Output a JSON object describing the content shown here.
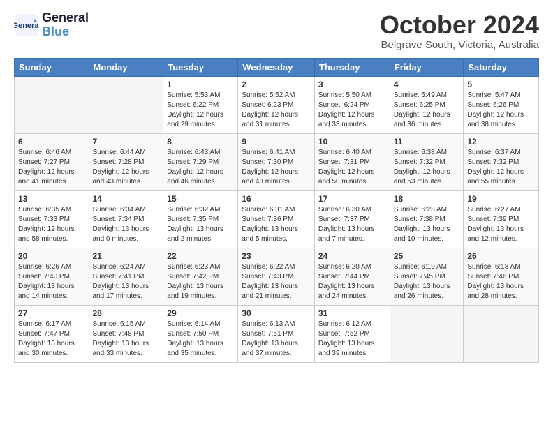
{
  "header": {
    "logo_line1": "General",
    "logo_line2": "Blue",
    "month": "October 2024",
    "location": "Belgrave South, Victoria, Australia"
  },
  "weekdays": [
    "Sunday",
    "Monday",
    "Tuesday",
    "Wednesday",
    "Thursday",
    "Friday",
    "Saturday"
  ],
  "weeks": [
    [
      {
        "day": "",
        "info": ""
      },
      {
        "day": "",
        "info": ""
      },
      {
        "day": "1",
        "info": "Sunrise: 5:53 AM\nSunset: 6:22 PM\nDaylight: 12 hours\nand 29 minutes."
      },
      {
        "day": "2",
        "info": "Sunrise: 5:52 AM\nSunset: 6:23 PM\nDaylight: 12 hours\nand 31 minutes."
      },
      {
        "day": "3",
        "info": "Sunrise: 5:50 AM\nSunset: 6:24 PM\nDaylight: 12 hours\nand 33 minutes."
      },
      {
        "day": "4",
        "info": "Sunrise: 5:49 AM\nSunset: 6:25 PM\nDaylight: 12 hours\nand 36 minutes."
      },
      {
        "day": "5",
        "info": "Sunrise: 5:47 AM\nSunset: 6:26 PM\nDaylight: 12 hours\nand 38 minutes."
      }
    ],
    [
      {
        "day": "6",
        "info": "Sunrise: 6:46 AM\nSunset: 7:27 PM\nDaylight: 12 hours\nand 41 minutes."
      },
      {
        "day": "7",
        "info": "Sunrise: 6:44 AM\nSunset: 7:28 PM\nDaylight: 12 hours\nand 43 minutes."
      },
      {
        "day": "8",
        "info": "Sunrise: 6:43 AM\nSunset: 7:29 PM\nDaylight: 12 hours\nand 46 minutes."
      },
      {
        "day": "9",
        "info": "Sunrise: 6:41 AM\nSunset: 7:30 PM\nDaylight: 12 hours\nand 48 minutes."
      },
      {
        "day": "10",
        "info": "Sunrise: 6:40 AM\nSunset: 7:31 PM\nDaylight: 12 hours\nand 50 minutes."
      },
      {
        "day": "11",
        "info": "Sunrise: 6:38 AM\nSunset: 7:32 PM\nDaylight: 12 hours\nand 53 minutes."
      },
      {
        "day": "12",
        "info": "Sunrise: 6:37 AM\nSunset: 7:32 PM\nDaylight: 12 hours\nand 55 minutes."
      }
    ],
    [
      {
        "day": "13",
        "info": "Sunrise: 6:35 AM\nSunset: 7:33 PM\nDaylight: 12 hours\nand 58 minutes."
      },
      {
        "day": "14",
        "info": "Sunrise: 6:34 AM\nSunset: 7:34 PM\nDaylight: 13 hours\nand 0 minutes."
      },
      {
        "day": "15",
        "info": "Sunrise: 6:32 AM\nSunset: 7:35 PM\nDaylight: 13 hours\nand 2 minutes."
      },
      {
        "day": "16",
        "info": "Sunrise: 6:31 AM\nSunset: 7:36 PM\nDaylight: 13 hours\nand 5 minutes."
      },
      {
        "day": "17",
        "info": "Sunrise: 6:30 AM\nSunset: 7:37 PM\nDaylight: 13 hours\nand 7 minutes."
      },
      {
        "day": "18",
        "info": "Sunrise: 6:28 AM\nSunset: 7:38 PM\nDaylight: 13 hours\nand 10 minutes."
      },
      {
        "day": "19",
        "info": "Sunrise: 6:27 AM\nSunset: 7:39 PM\nDaylight: 13 hours\nand 12 minutes."
      }
    ],
    [
      {
        "day": "20",
        "info": "Sunrise: 6:26 AM\nSunset: 7:40 PM\nDaylight: 13 hours\nand 14 minutes."
      },
      {
        "day": "21",
        "info": "Sunrise: 6:24 AM\nSunset: 7:41 PM\nDaylight: 13 hours\nand 17 minutes."
      },
      {
        "day": "22",
        "info": "Sunrise: 6:23 AM\nSunset: 7:42 PM\nDaylight: 13 hours\nand 19 minutes."
      },
      {
        "day": "23",
        "info": "Sunrise: 6:22 AM\nSunset: 7:43 PM\nDaylight: 13 hours\nand 21 minutes."
      },
      {
        "day": "24",
        "info": "Sunrise: 6:20 AM\nSunset: 7:44 PM\nDaylight: 13 hours\nand 24 minutes."
      },
      {
        "day": "25",
        "info": "Sunrise: 6:19 AM\nSunset: 7:45 PM\nDaylight: 13 hours\nand 26 minutes."
      },
      {
        "day": "26",
        "info": "Sunrise: 6:18 AM\nSunset: 7:46 PM\nDaylight: 13 hours\nand 28 minutes."
      }
    ],
    [
      {
        "day": "27",
        "info": "Sunrise: 6:17 AM\nSunset: 7:47 PM\nDaylight: 13 hours\nand 30 minutes."
      },
      {
        "day": "28",
        "info": "Sunrise: 6:15 AM\nSunset: 7:48 PM\nDaylight: 13 hours\nand 33 minutes."
      },
      {
        "day": "29",
        "info": "Sunrise: 6:14 AM\nSunset: 7:50 PM\nDaylight: 13 hours\nand 35 minutes."
      },
      {
        "day": "30",
        "info": "Sunrise: 6:13 AM\nSunset: 7:51 PM\nDaylight: 13 hours\nand 37 minutes."
      },
      {
        "day": "31",
        "info": "Sunrise: 6:12 AM\nSunset: 7:52 PM\nDaylight: 13 hours\nand 39 minutes."
      },
      {
        "day": "",
        "info": ""
      },
      {
        "day": "",
        "info": ""
      }
    ]
  ]
}
